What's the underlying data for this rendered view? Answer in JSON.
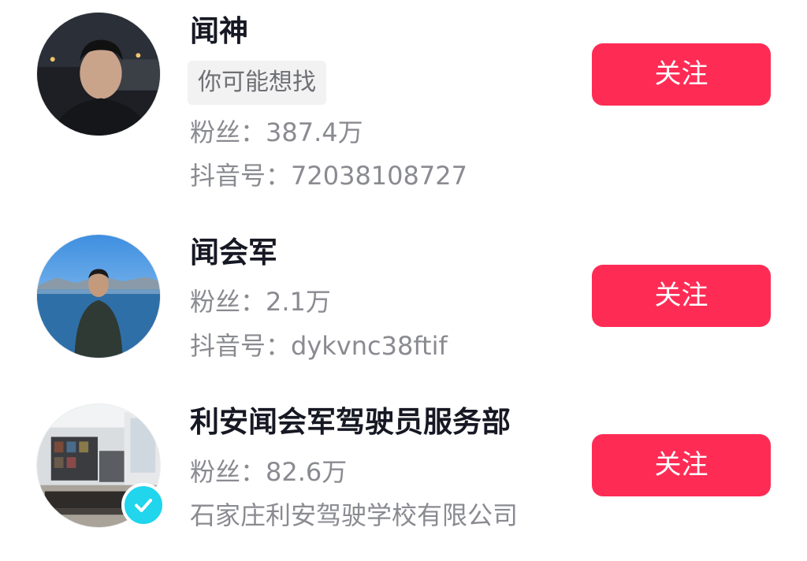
{
  "users": [
    {
      "name": "闻神",
      "tag": "你可能想找",
      "fans": "粉丝：387.4万",
      "douyin_id": "抖音号：72038108727",
      "follow_label": "关注"
    },
    {
      "name": "闻会军",
      "fans": "粉丝：2.1万",
      "douyin_id": "抖音号：dykvnc38ftif",
      "follow_label": "关注"
    },
    {
      "name": "利安闻会军驾驶员服务部",
      "fans": "粉丝：82.6万",
      "company": "石家庄利安驾驶学校有限公司",
      "verified": true,
      "follow_label": "关注"
    }
  ],
  "colors": {
    "follow_button": "#fe2c55",
    "verified_badge": "#20d5ec",
    "meta_text": "#8a8b91",
    "name_text": "#161823"
  },
  "icons": {
    "verified": "checkmark-icon"
  }
}
